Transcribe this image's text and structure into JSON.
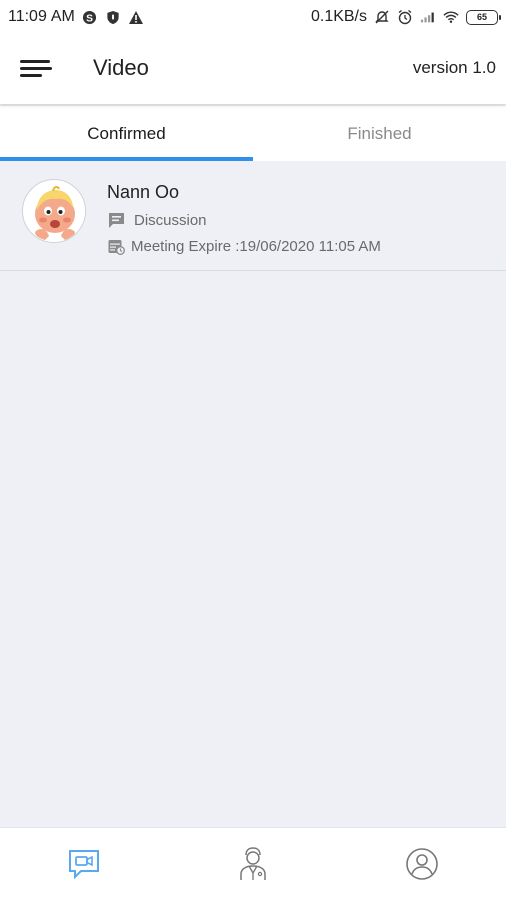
{
  "status_bar": {
    "time": "11:09",
    "ampm": "AM",
    "net_speed": "0.1KB/s",
    "battery": "65",
    "icons": [
      "skype-icon",
      "shield-icon",
      "warning-icon",
      "silent-icon",
      "alarm-icon",
      "signal-icon",
      "wifi-icon",
      "battery-icon"
    ]
  },
  "appbar": {
    "title": "Video",
    "version": "version 1.0",
    "menu_icon": "hamburger-menu-icon"
  },
  "tabs": [
    {
      "label": "Confirmed",
      "active": true
    },
    {
      "label": "Finished",
      "active": false
    }
  ],
  "meetings": [
    {
      "name": "Nann Oo",
      "topic": "Discussion",
      "expire": "Meeting Expire :19/06/2020 11:05 AM"
    }
  ],
  "bottom_nav": [
    {
      "icon": "video-chat-icon",
      "active": true
    },
    {
      "icon": "doctor-icon",
      "active": false
    },
    {
      "icon": "profile-icon",
      "active": false
    }
  ],
  "colors": {
    "accent": "#2f8fe9",
    "background": "#eef0f5",
    "inactive_tab": "#8a8a8a"
  }
}
